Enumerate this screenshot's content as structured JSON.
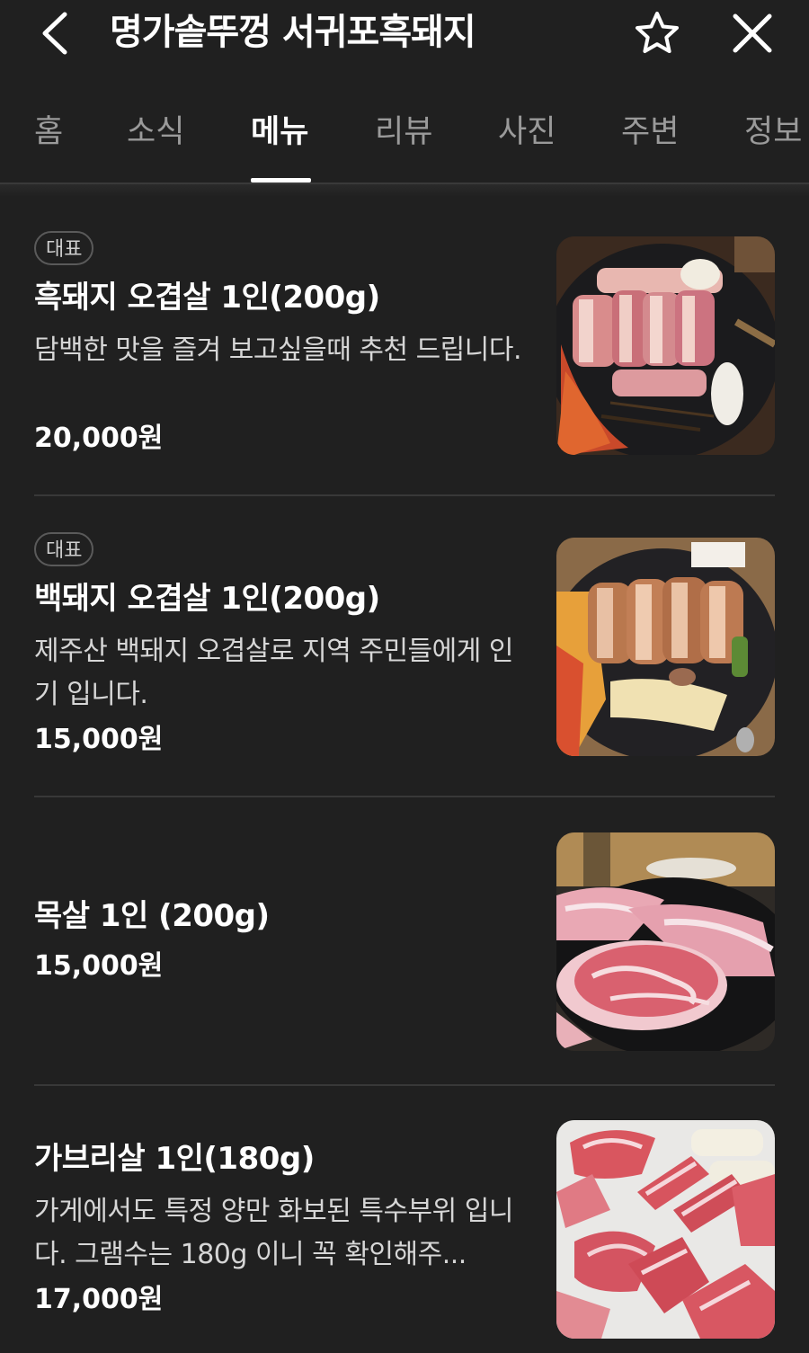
{
  "header": {
    "title": "명가솥뚜껑 서귀포흑돼지",
    "back_icon": "chevron-left-icon",
    "favorite_icon": "star-outline-icon",
    "close_icon": "close-icon"
  },
  "tabs": [
    {
      "label": "홈",
      "active": false
    },
    {
      "label": "소식",
      "active": false
    },
    {
      "label": "메뉴",
      "active": true
    },
    {
      "label": "리뷰",
      "active": false
    },
    {
      "label": "사진",
      "active": false
    },
    {
      "label": "주변",
      "active": false
    },
    {
      "label": "정보",
      "active": false
    }
  ],
  "menu": [
    {
      "badge": "대표",
      "name": "흑돼지 오겹살 1인(200g)",
      "desc": "담백한 맛을 즐겨 보고싶을때 추천 드립니다.",
      "price": "20,000원"
    },
    {
      "badge": "대표",
      "name": "백돼지 오겹살 1인(200g)",
      "desc": "제주산 백돼지 오겹살로 지역 주민들에게 인기 입니다.",
      "price": "15,000원"
    },
    {
      "badge": "",
      "name": "목살 1인 (200g)",
      "desc": "",
      "price": "15,000원"
    },
    {
      "badge": "",
      "name": "가브리살 1인(180g)",
      "desc": "가게에서도 특정 양만 화보된 특수부위 입니다. 그램수는 180g 이니 꼭 확인해주...",
      "price": "17,000원"
    }
  ],
  "colors": {
    "background": "#202020",
    "active_tab": "#ffffff",
    "inactive_tab": "#9a9a9a",
    "badge_border": "#5a5a5a"
  }
}
